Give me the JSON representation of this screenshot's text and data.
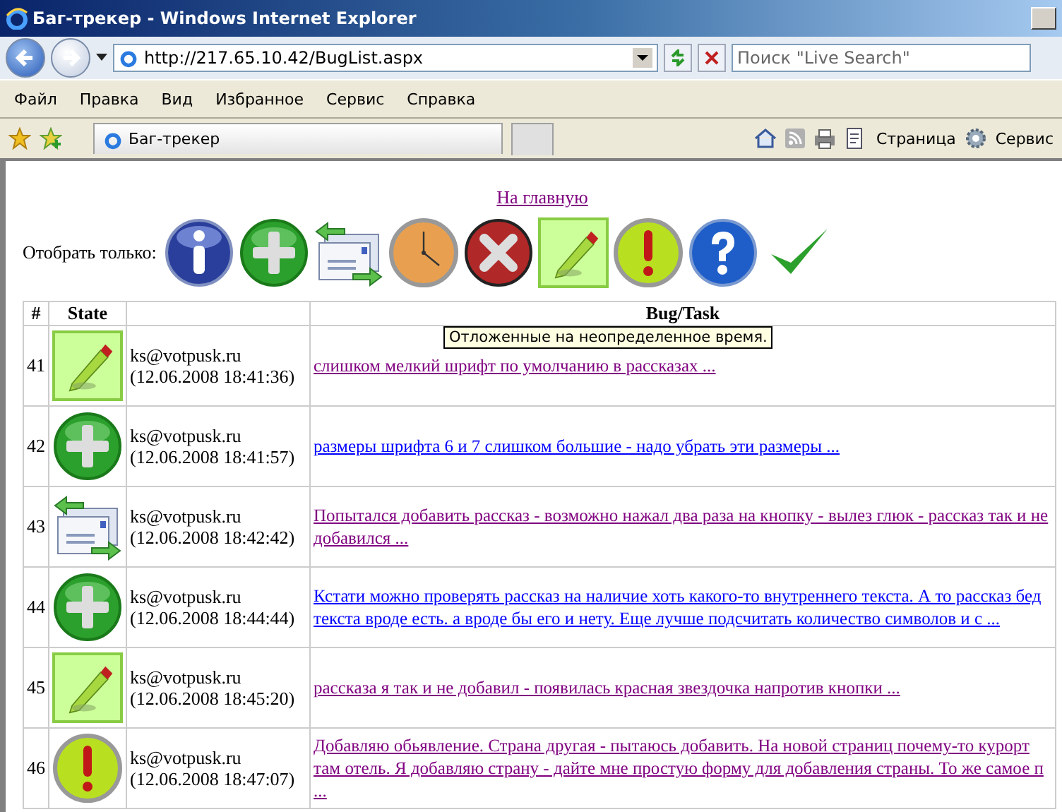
{
  "window": {
    "title": "Баг-трекер - Windows Internet Explorer"
  },
  "address_bar": {
    "url": "http://217.65.10.42/BugList.aspx"
  },
  "search": {
    "placeholder": "Поиск \"Live Search\""
  },
  "menu": [
    "Файл",
    "Правка",
    "Вид",
    "Избранное",
    "Сервис",
    "Справка"
  ],
  "tab": {
    "title": "Баг-трекер"
  },
  "command_bar": {
    "page": "Страница",
    "tools": "Сервис"
  },
  "page": {
    "home_link": "На главную",
    "filter": {
      "label": "Отобрать только:",
      "icons": [
        {
          "kind": "info",
          "selected": false
        },
        {
          "kind": "new",
          "selected": false
        },
        {
          "kind": "forwarded",
          "selected": false
        },
        {
          "kind": "clock",
          "selected": false
        },
        {
          "kind": "cancel",
          "selected": false
        },
        {
          "kind": "edit",
          "selected": true
        },
        {
          "kind": "alert",
          "selected": false
        },
        {
          "kind": "question",
          "selected": false
        },
        {
          "kind": "done",
          "selected": false
        }
      ]
    },
    "tooltip": "Отложенные на неопределенное время.",
    "table": {
      "columns": [
        "#",
        "State",
        "",
        "Bug/Task"
      ],
      "rows": [
        {
          "number": "41",
          "kind": "edit",
          "user": "ks@votpusk.ru",
          "time": "(12.06.2008 18:41:36)",
          "text": "слишком мелкий шрифт по умолчанию в рассказах ...",
          "visited": true
        },
        {
          "number": "42",
          "kind": "new",
          "user": "ks@votpusk.ru",
          "time": "(12.06.2008 18:41:57)",
          "text": "размеры шрифта 6 и 7 слишком большие - надо убрать эти размеры ...",
          "visited": false
        },
        {
          "number": "43",
          "kind": "forwarded",
          "user": "ks@votpusk.ru",
          "time": "(12.06.2008 18:42:42)",
          "text": "Попытался добавить рассказ - возможно нажал два раза на кнопку - вылез глюк - рассказ так и не добавился ...",
          "visited": true
        },
        {
          "number": "44",
          "kind": "new",
          "user": "ks@votpusk.ru",
          "time": "(12.06.2008 18:44:44)",
          "text": "Кстати можно проверять рассказ на наличие хоть какого-то внутреннего текста. А то рассказ бед текста вроде есть. а вроде бы его и нету. Еще лучше подсчитать количество символов и с ...",
          "visited": false
        },
        {
          "number": "45",
          "kind": "edit",
          "user": "ks@votpusk.ru",
          "time": "(12.06.2008 18:45:20)",
          "text": "рассказа я так и не добавил - появилась красная звездочка напротив кнопки ...",
          "visited": true
        },
        {
          "number": "46",
          "kind": "alert",
          "user": "ks@votpusk.ru",
          "time": "(12.06.2008 18:47:07)",
          "text": "Добавляю обьявление. Страна другая - пытаюсь добавить. На новой страниц почему-то курорт там отель. Я добавляю страну - дайте мне простую форму для добавления страны. То же самое п ...",
          "visited": true
        }
      ]
    }
  }
}
